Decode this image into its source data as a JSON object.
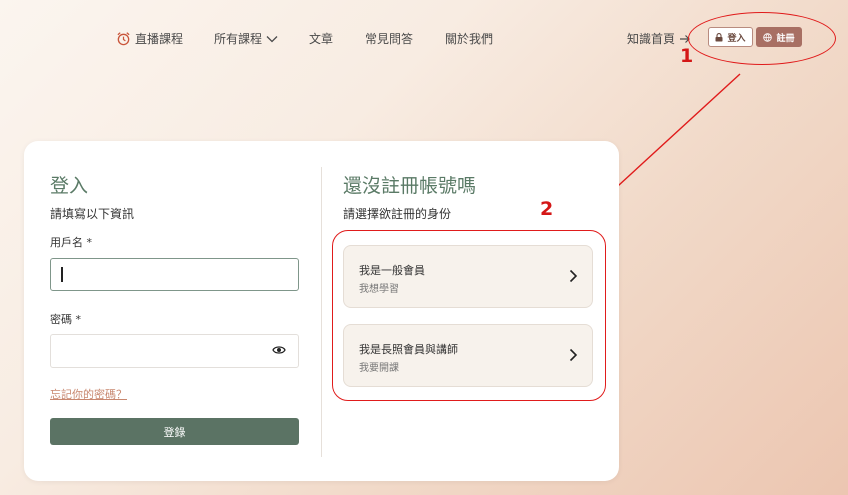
{
  "nav": {
    "live": "直播課程",
    "courses": "所有課程",
    "articles": "文章",
    "faq": "常見問答",
    "about": "關於我們",
    "knowledge": "知識首頁",
    "login_btn": "登入",
    "register_btn": "註冊"
  },
  "annotations": {
    "one": "1",
    "two": "2"
  },
  "login": {
    "title": "登入",
    "subtitle": "請填寫以下資訊",
    "username_label": "用戶名 *",
    "username_value": "",
    "password_label": "密碼 *",
    "password_value": "",
    "forgot": "忘記你的密碼？",
    "submit": "登錄"
  },
  "register": {
    "title": "還沒註冊帳號嗎",
    "subtitle": "請選擇欲註冊的身份",
    "options": [
      {
        "title": "我是一般會員",
        "desc": "我想學習"
      },
      {
        "title": "我是長照會員與講師",
        "desc": "我要開課"
      }
    ]
  },
  "colors": {
    "accent_green": "#5b7364",
    "brand_rose": "#a86f63",
    "annotation_red": "#e01b1b"
  }
}
